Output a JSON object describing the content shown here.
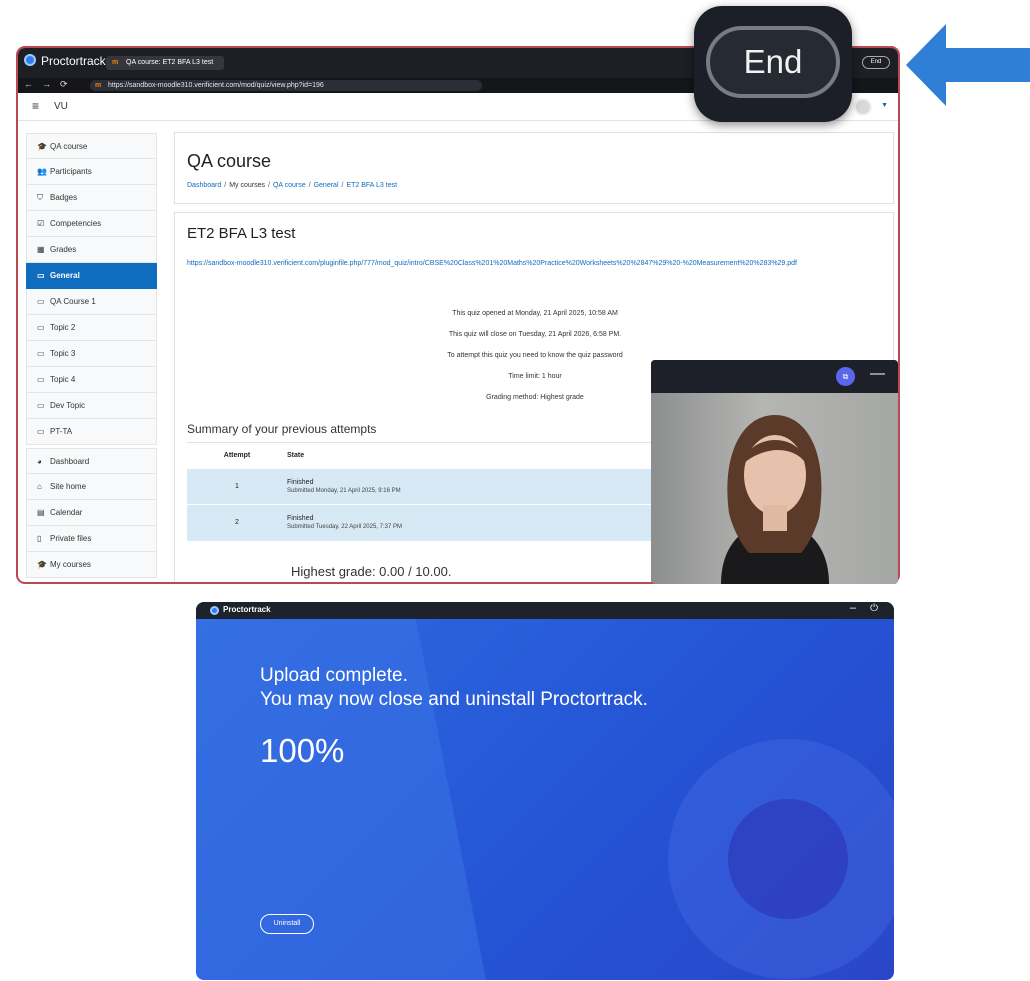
{
  "browser": {
    "app_name": "Proctortrack",
    "tab_favicon": "m",
    "tab_title": "QA course: ET2 BFA L3 test",
    "end_label": "End",
    "url": "https://sandbox-moodle310.verificient.com/mod/quiz/view.php?id=196"
  },
  "header": {
    "site_name": "VU"
  },
  "sidebar": {
    "items": [
      {
        "icon": "graduation-cap-icon",
        "glyph": "🎓",
        "label": "QA course"
      },
      {
        "icon": "users-icon",
        "glyph": "👥",
        "label": "Participants"
      },
      {
        "icon": "shield-icon",
        "glyph": "⛉",
        "label": "Badges"
      },
      {
        "icon": "check-square-icon",
        "glyph": "☑",
        "label": "Competencies"
      },
      {
        "icon": "table-icon",
        "glyph": "▦",
        "label": "Grades"
      },
      {
        "icon": "folder-icon",
        "glyph": "▭",
        "label": "General"
      },
      {
        "icon": "folder-icon",
        "glyph": "▭",
        "label": "QA Course 1"
      },
      {
        "icon": "folder-icon",
        "glyph": "▭",
        "label": "Topic 2"
      },
      {
        "icon": "folder-icon",
        "glyph": "▭",
        "label": "Topic 3"
      },
      {
        "icon": "folder-icon",
        "glyph": "▭",
        "label": "Topic 4"
      },
      {
        "icon": "folder-icon",
        "glyph": "▭",
        "label": "Dev Topic"
      },
      {
        "icon": "folder-icon",
        "glyph": "▭",
        "label": "PT-TA"
      },
      {
        "icon": "dashboard-icon",
        "glyph": "◕",
        "label": "Dashboard"
      },
      {
        "icon": "home-icon",
        "glyph": "⌂",
        "label": "Site home"
      },
      {
        "icon": "calendar-icon",
        "glyph": "▤",
        "label": "Calendar"
      },
      {
        "icon": "file-icon",
        "glyph": "▯",
        "label": "Private files"
      },
      {
        "icon": "graduation-cap-icon",
        "glyph": "🎓",
        "label": "My courses"
      }
    ]
  },
  "course": {
    "title": "QA course",
    "breadcrumb": [
      "Dashboard",
      "My courses",
      "QA course",
      "General",
      "ET2 BFA L3 test"
    ]
  },
  "quiz": {
    "title": "ET2 BFA L3 test",
    "link": "https://sandbox-moodle310.verificient.com/pluginfile.php/777/mod_quiz/intro/CBSE%20Class%201%20Maths%20Practice%20Worksheets%20%2847%29%20-%20Measurement%20%283%29.pdf",
    "info": [
      "This quiz opened at Monday, 21 April 2025, 10:58 AM",
      "This quiz will close on Tuesday, 21 April 2026, 6:58 PM.",
      "To attempt this quiz you need to know the quiz password",
      "Time limit: 1 hour",
      "Grading method: Highest grade"
    ],
    "summary_title": "Summary of your previous attempts",
    "table_headers": [
      "Attempt",
      "State"
    ],
    "attempts": [
      {
        "attempt": "1",
        "state": "Finished",
        "submitted": "Submitted Monday, 21 April 2025, 9:16 PM"
      },
      {
        "attempt": "2",
        "state": "Finished",
        "submitted": "Submitted Tuesday, 22 April 2025, 7:37 PM"
      }
    ],
    "highest_grade": "Highest grade: 0.00 / 10.00."
  },
  "zoom_callout": {
    "label": "End"
  },
  "upload": {
    "app_name": "Proctortrack",
    "message_line1": "Upload complete.",
    "message_line2": "You may now close and uninstall Proctortrack.",
    "progress_text": "100%",
    "progress": 1.0,
    "uninstall_label": "Uninstall"
  },
  "colors": {
    "moodle_blue": "#0f6cbf",
    "arrow_blue": "#2f7fd6",
    "upload_bg": "#2a5bd8",
    "table_row": "#d7e9f5"
  }
}
